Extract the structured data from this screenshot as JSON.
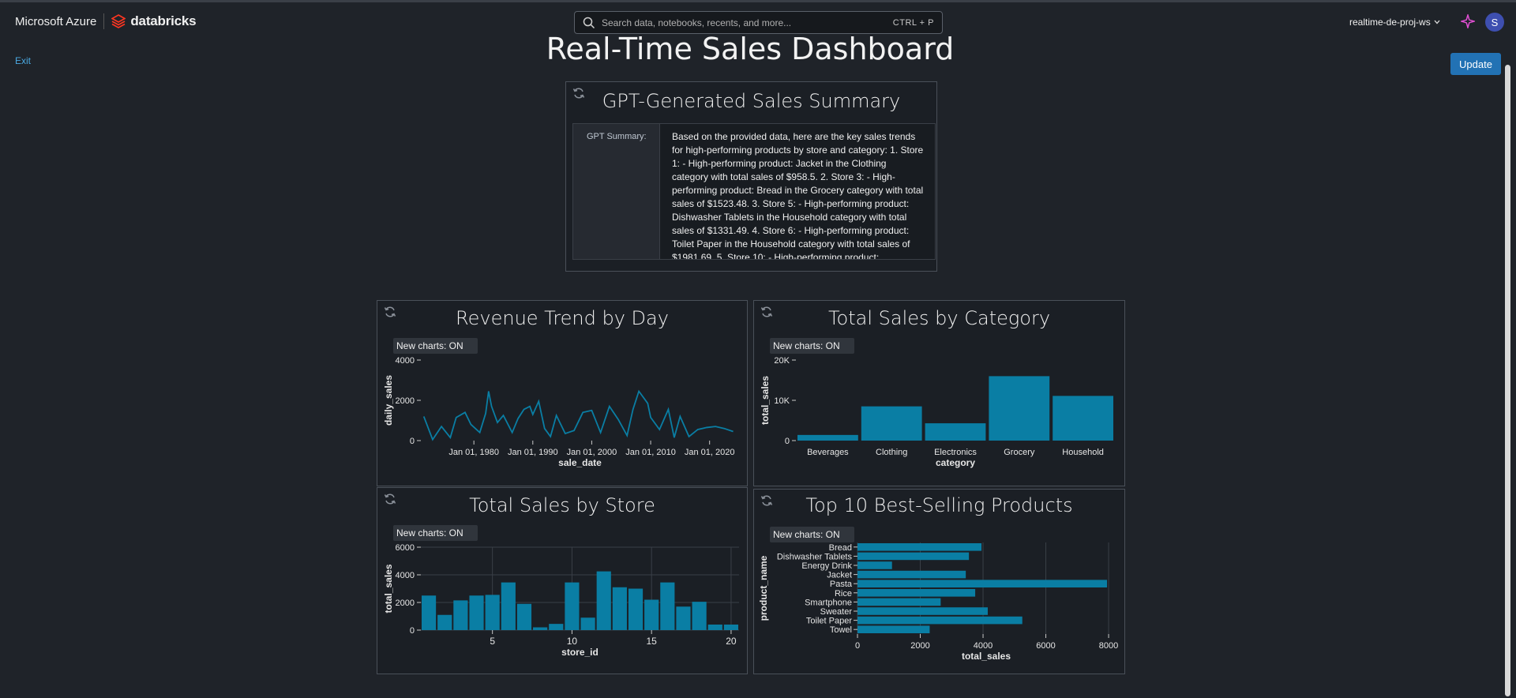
{
  "topbar": {
    "azure_label": "Microsoft Azure",
    "databricks_label": "databricks",
    "search_placeholder": "Search data, notebooks, recents, and more...",
    "search_shortcut": "CTRL + P",
    "workspace": "realtime-de-proj-ws",
    "avatar_initial": "S"
  },
  "page": {
    "title": "Real-Time Sales Dashboard",
    "exit_label": "Exit",
    "update_label": "Update"
  },
  "summary_card": {
    "title": "GPT-Generated Sales Summary",
    "label": "GPT Summary:",
    "text": "Based on the provided data, here are the key sales trends for high-performing products by store and category: 1. Store 1: - High-performing product: Jacket in the Clothing category with total sales of $958.5. 2. Store 3: - High-performing product: Bread in the Grocery category with total sales of $1523.48. 3. Store 5: - High-performing product: Dishwasher Tablets in the Household category with total sales of $1331.49. 4. Store 6: - High-performing product: Toilet Paper in the Household category with total sales of $1981.69. 5. Store 10: - High-performing product:"
  },
  "chip_label": "New charts: ON",
  "colors": {
    "bar": "#0a7ea4",
    "accent": "#2272b4",
    "link": "#4aa8e0",
    "background": "#1f2329"
  },
  "chart_data": [
    {
      "id": "revenue",
      "type": "line",
      "title": "Revenue Trend by Day",
      "xlabel": "sale_date",
      "ylabel": "daily_sales",
      "xlim": [
        1971,
        2025
      ],
      "ylim": [
        0,
        4000
      ],
      "yticks": [
        0,
        2000,
        4000
      ],
      "yticklabels": [
        "0",
        "2000",
        "4000"
      ],
      "xticks": [
        1980,
        1990,
        2000,
        2010,
        2020
      ],
      "xticklabels": [
        "Jan 01, 1980",
        "Jan 01, 1990",
        "Jan 01, 2000",
        "Jan 01, 2010",
        "Jan 01, 2020"
      ],
      "x": [
        1971.5,
        1973,
        1974.5,
        1976,
        1977,
        1978.5,
        1979.5,
        1981,
        1982,
        1982.5,
        1983,
        1984,
        1985,
        1986.5,
        1987.5,
        1988.5,
        1989.5,
        1990,
        1991,
        1992,
        1993,
        1994,
        1995.5,
        1997,
        1998.5,
        2000,
        2001.5,
        2003,
        2004.5,
        2006,
        2007,
        2008,
        2009.5,
        2010,
        2011.5,
        2013,
        2014,
        2015,
        2016.5,
        2018,
        2019.5,
        2021,
        2022.5,
        2024
      ],
      "y": [
        1200,
        50,
        700,
        150,
        1150,
        1400,
        800,
        400,
        1350,
        2450,
        1700,
        900,
        1250,
        400,
        1100,
        1550,
        1700,
        1300,
        1950,
        600,
        200,
        1250,
        350,
        500,
        1400,
        1500,
        400,
        1700,
        1050,
        250,
        1550,
        2450,
        1850,
        1150,
        550,
        1550,
        150,
        1200,
        200,
        550,
        650,
        700,
        600,
        450
      ]
    },
    {
      "id": "category",
      "type": "bar",
      "title": "Total Sales by Category",
      "xlabel": "category",
      "ylabel": "total_sales",
      "ylim": [
        0,
        20000
      ],
      "yticks": [
        0,
        10000,
        20000
      ],
      "yticklabels": [
        "0",
        "10K",
        "20K"
      ],
      "categories": [
        "Beverages",
        "Clothing",
        "Electronics",
        "Grocery",
        "Household"
      ],
      "values": [
        1400,
        8500,
        4300,
        16000,
        11100
      ]
    },
    {
      "id": "store",
      "type": "bar",
      "title": "Total Sales by Store",
      "xlabel": "store_id",
      "ylabel": "total_sales",
      "xlim": [
        0.5,
        20.5
      ],
      "ylim": [
        0,
        6000
      ],
      "yticks": [
        0,
        2000,
        4000,
        6000
      ],
      "yticklabels": [
        "0",
        "2000",
        "4000",
        "6000"
      ],
      "xticks": [
        5,
        10,
        15,
        20
      ],
      "xticklabels": [
        "5",
        "10",
        "15",
        "20"
      ],
      "categories": [
        1,
        2,
        3,
        4,
        5,
        6,
        7,
        8,
        9,
        10,
        11,
        12,
        13,
        14,
        15,
        16,
        17,
        18,
        19,
        20
      ],
      "values": [
        2500,
        1100,
        2150,
        2500,
        2550,
        3450,
        1900,
        200,
        450,
        3450,
        900,
        4250,
        3100,
        3000,
        2200,
        3450,
        1700,
        2050,
        400,
        400
      ]
    },
    {
      "id": "products",
      "type": "bar",
      "orientation": "horizontal",
      "title": "Top 10 Best-Selling Products",
      "xlabel": "total_sales",
      "ylabel": "product_name",
      "xlim": [
        0,
        8200
      ],
      "xticks": [
        0,
        2000,
        4000,
        6000,
        8000
      ],
      "xticklabels": [
        "0",
        "2000",
        "4000",
        "6000",
        "8000"
      ],
      "categories": [
        "Bread",
        "Dishwasher Tablets",
        "Energy Drink",
        "Jacket",
        "Pasta",
        "Rice",
        "Smartphone",
        "Sweater",
        "Toilet Paper",
        "Towel"
      ],
      "values": [
        3950,
        3550,
        1100,
        3450,
        7950,
        3750,
        2650,
        4150,
        5250,
        2300
      ]
    }
  ]
}
